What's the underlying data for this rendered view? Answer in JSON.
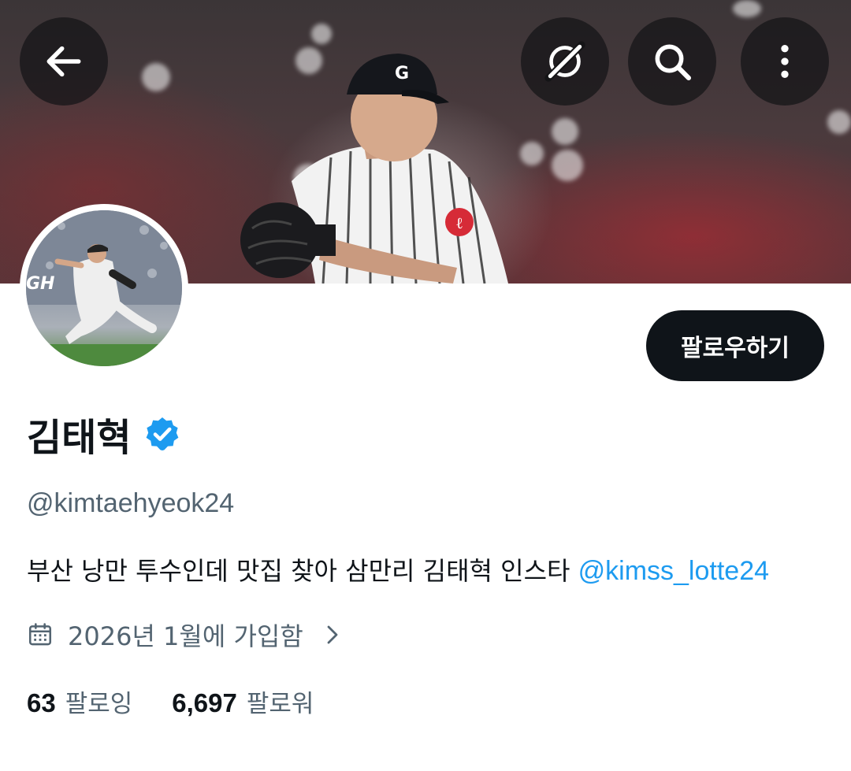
{
  "header": {
    "back_icon": "arrow-left-icon",
    "grok_icon": "grok-slash-icon",
    "search_icon": "search-icon",
    "more_icon": "more-vertical-icon"
  },
  "profile": {
    "follow_label": "팔로우하기",
    "display_name": "김태혁",
    "verified_icon": "verified-badge-icon",
    "verified_color": "#1d9bf0",
    "handle": "@kimtaehyeok24",
    "bio_text": "부산 낭만 투수인데 맛집 찾아 삼만리 김태혁  인스타 ",
    "bio_link": "@kimss_lotte24",
    "joined_icon": "calendar-icon",
    "joined_text": "2026년 1월에 가입함",
    "following_count": "63",
    "following_label": "팔로잉",
    "followers_count": "6,697",
    "followers_label": "팔로워"
  },
  "colors": {
    "primary_text": "#0f1419",
    "secondary_text": "#536471",
    "link": "#1d9bf0",
    "follow_button": "#0f1419"
  }
}
